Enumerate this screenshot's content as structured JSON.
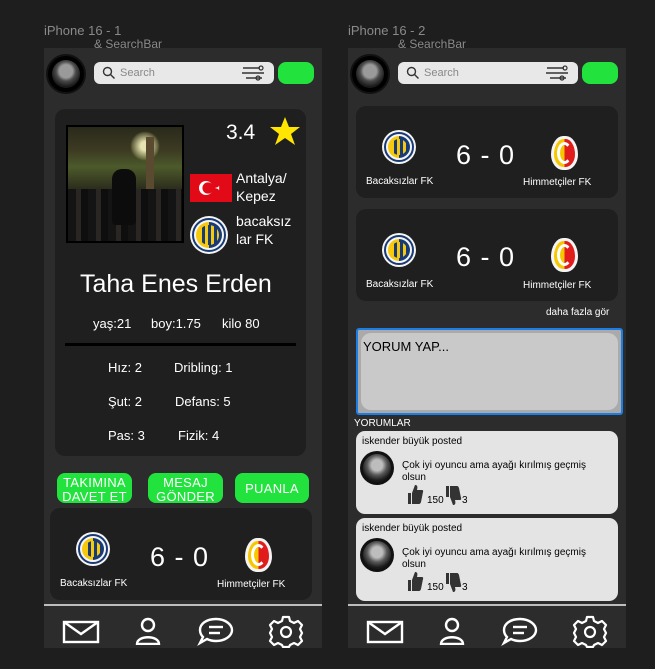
{
  "frames": [
    {
      "title": "iPhone 16 - 1",
      "subtitle": "& SearchBar"
    },
    {
      "title": "iPhone 16 - 2",
      "subtitle": "& SearchBar"
    }
  ],
  "search": {
    "placeholder": "Search"
  },
  "profile": {
    "rating": "3.4",
    "location_line1": "Antalya/",
    "location_line2": "Kepez",
    "team_line1": "bacaksız",
    "team_line2": "lar FK",
    "name": "Taha Enes Erden",
    "age": "yaş:21",
    "height": "boy:1.75",
    "weight": "kilo 80",
    "stats": {
      "speed": "Hız: 2",
      "dribbling": "Dribling: 1",
      "shooting": "Şut: 2",
      "defense": "Defans: 5",
      "passing": "Pas: 3",
      "physical": "Fizik: 4"
    }
  },
  "actions": {
    "invite_line1": "TAKIMINA",
    "invite_line2": "DAVET ET",
    "message_line1": "MESAJ",
    "message_line2": "GÖNDER",
    "rate": "PUANLA"
  },
  "match": {
    "home": "Bacaksızlar FK",
    "away": "Himmetçiler FK",
    "score": "6 - 0"
  },
  "see_more": "daha fazla gör",
  "comment_input": {
    "placeholder": "YORUM YAP..."
  },
  "comments_label": "YORUMLAR",
  "comments": [
    {
      "author": "iskender büyük posted",
      "text": "Çok iyi oyuncu ama ayağı kırılmış geçmiş olsun",
      "likes": "150",
      "dislikes": "3"
    },
    {
      "author": "iskender büyük posted",
      "text": "Çok iyi oyuncu ama ayağı kırılmış geçmiş olsun",
      "likes": "150",
      "dislikes": "3"
    }
  ],
  "colors": {
    "accent_green": "#22e33e",
    "selection_blue": "#1a7ee6",
    "star_yellow": "#ffe500"
  },
  "icons": [
    "mail-icon",
    "profile-icon",
    "chat-icon",
    "gear-icon",
    "search-icon",
    "filter-icon",
    "star-icon",
    "thumbs-up-icon",
    "thumbs-down-icon"
  ]
}
